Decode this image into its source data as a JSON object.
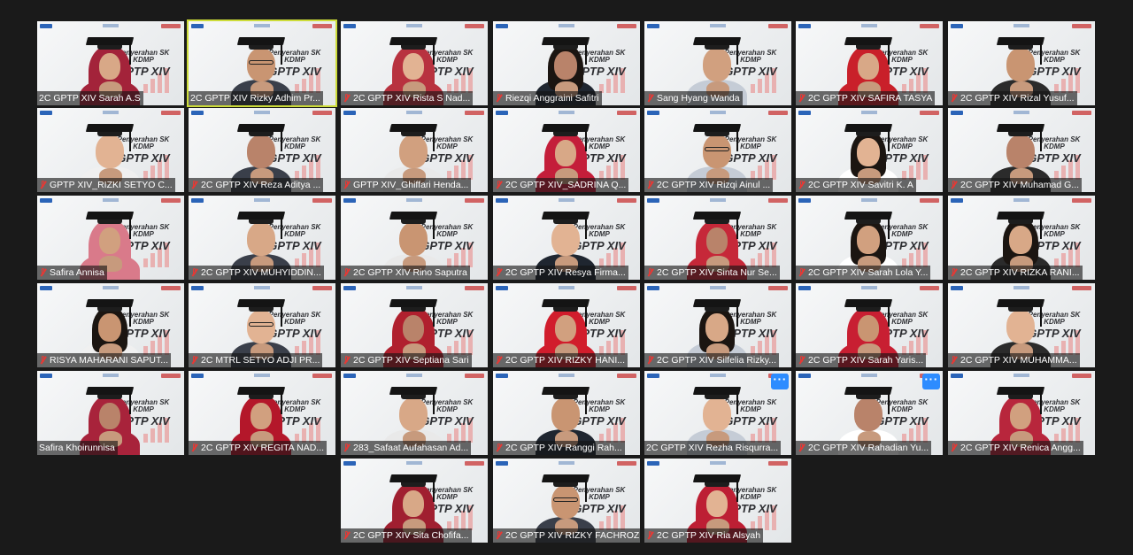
{
  "banner": {
    "title": "Penyerahan SK KDMP",
    "subtitle": "GPTP XIV"
  },
  "colors": {
    "active_border": "#cddc39",
    "muted_mic": "#e53935",
    "more_button": "#2d8cff",
    "background": "#1a1a1a"
  },
  "participants": [
    {
      "name": "2C GPTP XIV Sarah A.S",
      "look": "hijab",
      "hijab": "#a3233a",
      "muted": false
    },
    {
      "name": "2C GPTP XIV Rizky Adhim Pr...",
      "look": "male-glasses",
      "muted": false,
      "active": true
    },
    {
      "name": "2C GPTP XIV Rista S Nad...",
      "look": "hijab",
      "hijab": "#b8323f",
      "muted": true
    },
    {
      "name": "Riezqi Anggraini Safitri",
      "look": "hair",
      "muted": true
    },
    {
      "name": "Sang Hyang Wanda",
      "look": "male",
      "muted": true
    },
    {
      "name": "2C GPTP XIV SAFIRA TASYA",
      "look": "hijab",
      "hijab": "#c9202a",
      "muted": true
    },
    {
      "name": "2C GPTP XIV Rizal Yusuf...",
      "look": "male",
      "muted": true
    },
    {
      "name": "GPTP XIV_RIZKI SETYO C...",
      "look": "male",
      "muted": true
    },
    {
      "name": "2C GPTP XIV Reza Aditya ...",
      "look": "male",
      "muted": true
    },
    {
      "name": "GPTP XIV_Ghiffari Henda...",
      "look": "male",
      "muted": true
    },
    {
      "name": "2C GPTP XIV_SADRINA Q...",
      "look": "hijab",
      "hijab": "#c41e3a",
      "muted": true
    },
    {
      "name": "2C GPTP XIV Rizqi Ainul ...",
      "look": "male-glasses",
      "muted": true
    },
    {
      "name": "2C GPTP XIV Savitri K. A",
      "look": "hair",
      "muted": true
    },
    {
      "name": "2C GPTP XIV Muhamad G...",
      "look": "male",
      "muted": true
    },
    {
      "name": "Safira Annisa",
      "look": "hijab",
      "hijab": "#d97a8a",
      "muted": true
    },
    {
      "name": "2C GPTP XIV MUHYIDDIN...",
      "look": "male",
      "muted": true
    },
    {
      "name": "2C GPTP XIV Rino Saputra",
      "look": "male",
      "muted": true
    },
    {
      "name": "2C GPTP XIV Resya Firma...",
      "look": "male",
      "muted": true
    },
    {
      "name": "2C GPTP XIV Sinta Nur Se...",
      "look": "hijab",
      "hijab": "#c62839",
      "muted": true
    },
    {
      "name": "2C GPTP XIV Sarah Lola Y...",
      "look": "hair",
      "muted": true
    },
    {
      "name": "2C GPTP XIV RIZKA RANI...",
      "look": "hair",
      "muted": true
    },
    {
      "name": "RISYA MAHARANI SAPUT...",
      "look": "hair",
      "muted": true
    },
    {
      "name": "2C MTRL SETYO ADJI PR...",
      "look": "male-glasses",
      "muted": true
    },
    {
      "name": "2C GPTP XIV Septiana Sari",
      "look": "hijab",
      "hijab": "#b0202e",
      "muted": true
    },
    {
      "name": "2C GPTP XIV RIZKY HANI...",
      "look": "hijab",
      "hijab": "#d11d2c",
      "muted": true
    },
    {
      "name": "2C GPTP XIV Silfelia Rizky...",
      "look": "hair",
      "muted": true
    },
    {
      "name": "2C GPTP XIV Sarah Yaris...",
      "look": "hijab",
      "hijab": "#c81f32",
      "muted": true
    },
    {
      "name": "2C GPTP XIV MUHAMMA...",
      "look": "male",
      "muted": true
    },
    {
      "name": "Safira Khoirunnisa",
      "look": "hijab",
      "hijab": "#a8233b",
      "muted": false
    },
    {
      "name": "2C GPTP XIV REGITA NAD...",
      "look": "hijab",
      "hijab": "#b4172a",
      "muted": true
    },
    {
      "name": "283_Safaat Aufahasan Ad...",
      "look": "male",
      "muted": true
    },
    {
      "name": "2C GPTP XIV Ranggi Rah...",
      "look": "male",
      "muted": true
    },
    {
      "name": "2C GPTP XIV Rezha Risqurra...",
      "look": "male",
      "muted": false,
      "more": true
    },
    {
      "name": "2C GPTP XIV Rahadian Yu...",
      "look": "male",
      "muted": true,
      "more": true
    },
    {
      "name": "2C GPTP XIV Renica Angg...",
      "look": "hijab",
      "hijab": "#b8263c",
      "muted": true
    },
    {
      "name": "2C GPTP XIV Sita Chofifa...",
      "look": "hijab",
      "hijab": "#a01f30",
      "muted": true
    },
    {
      "name": "2C GPTP XIV RIZKY FACHROZI",
      "look": "male-glasses",
      "muted": true
    },
    {
      "name": "2C GPTP XIV Ria Alsyah",
      "look": "hijab",
      "hijab": "#bd1f34",
      "muted": true
    }
  ],
  "more_label": "···"
}
